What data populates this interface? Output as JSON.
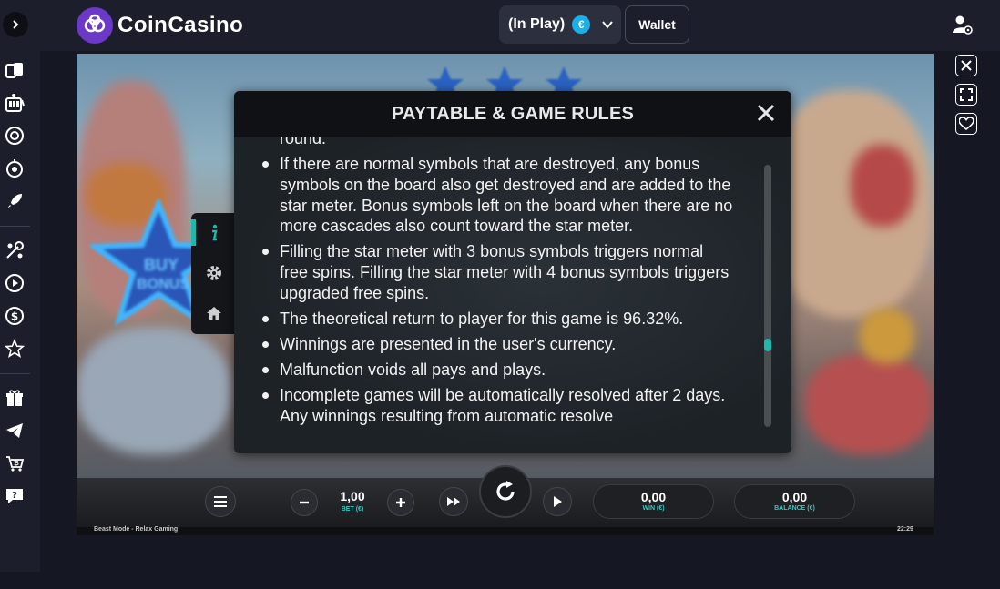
{
  "header": {
    "logo_text": "CoinCasino",
    "in_play_label": "(In Play)",
    "currency_symbol": "€",
    "wallet_label": "Wallet"
  },
  "sidebar": {
    "items": [
      {
        "icon": "cards-icon"
      },
      {
        "icon": "slot-machine-icon"
      },
      {
        "icon": "casino-chip-icon"
      },
      {
        "icon": "roulette-icon"
      },
      {
        "icon": "rocket-icon"
      },
      {
        "icon": "sports-icon"
      },
      {
        "icon": "play-circle-icon"
      },
      {
        "icon": "dollar-coin-icon"
      },
      {
        "icon": "star-icon"
      },
      {
        "icon": "gift-icon"
      },
      {
        "icon": "telegram-icon"
      },
      {
        "icon": "bitcoin-cart-icon"
      },
      {
        "icon": "help-chat-icon"
      }
    ]
  },
  "modal": {
    "title": "PAYTABLE & GAME RULES",
    "rules": [
      "round.",
      "If there are normal symbols that are destroyed, any bonus symbols on the board also get destroyed and are added to the star meter. Bonus symbols left on the board when there are no more cascades also count toward the star meter.",
      "Filling the star meter with 3 bonus symbols triggers normal free spins. Filling the star meter with 4 bonus symbols triggers upgraded free spins.",
      "The theoretical return to player for this game is 96.32%.",
      "Winnings are presented in the user's currency.",
      "Malfunction voids all pays and plays.",
      "Incomplete games will be automatically resolved after 2 days. Any winnings resulting from automatic resolve"
    ]
  },
  "game": {
    "bet_value": "1,00",
    "bet_label": "BET (€)",
    "win_value": "0,00",
    "win_label": "WIN (€)",
    "balance_value": "0,00",
    "balance_label": "BALANCE (€)",
    "footer_left": "Beast Mode - Relax Gaming",
    "footer_time": "22:29",
    "accent_color": "#20b8ad"
  },
  "scene_text": {
    "sign_top": "BUY",
    "sign_bottom": "BONUS"
  }
}
